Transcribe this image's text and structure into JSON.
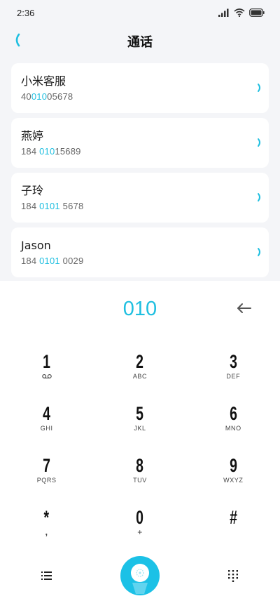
{
  "status": {
    "time": "2:36",
    "icons": [
      "signal-icon",
      "wifi-icon",
      "battery-icon"
    ]
  },
  "header": {
    "title": "通话",
    "back_icon": "chevron-left-icon"
  },
  "contacts": [
    {
      "name": "小米客服",
      "number_pre": "40",
      "number_match": "010",
      "number_post": "05678"
    },
    {
      "name": "燕婷",
      "number_pre": "184 ",
      "number_match": "010",
      "number_post": "15689"
    },
    {
      "name": "子玲",
      "number_pre": "184 ",
      "number_match": "0101",
      "number_post": " 5678"
    },
    {
      "name": "Jason",
      "number_pre": "184 ",
      "number_match": "0101",
      "number_post": " 0029"
    }
  ],
  "dialer": {
    "input": "010",
    "backspace_icon": "backspace-arrow-icon",
    "keys": [
      {
        "digit": "1",
        "letters": "",
        "icon": "voicemail-icon"
      },
      {
        "digit": "2",
        "letters": "ABC"
      },
      {
        "digit": "3",
        "letters": "DEF"
      },
      {
        "digit": "4",
        "letters": "GHI"
      },
      {
        "digit": "5",
        "letters": "JKL"
      },
      {
        "digit": "6",
        "letters": "MNO"
      },
      {
        "digit": "7",
        "letters": "PQRS"
      },
      {
        "digit": "8",
        "letters": "TUV"
      },
      {
        "digit": "9",
        "letters": "WXYZ"
      },
      {
        "digit": "*",
        "letters": ","
      },
      {
        "digit": "0",
        "letters": "+"
      },
      {
        "digit": "#",
        "letters": ""
      }
    ]
  },
  "bottom": {
    "menu_icon": "list-menu-icon",
    "call_icon": "phone-call-icon",
    "keypad_icon": "dialpad-icon"
  },
  "colors": {
    "accent": "#1fbfe0",
    "background": "#f4f5f8"
  }
}
